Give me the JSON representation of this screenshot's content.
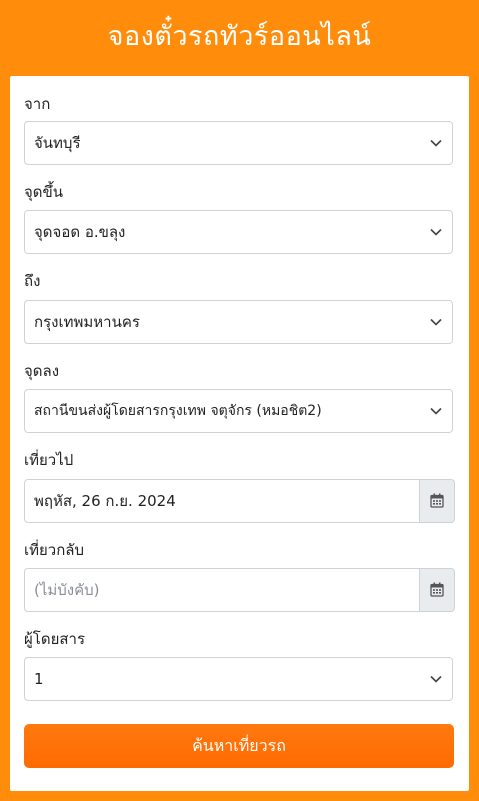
{
  "header": {
    "title": "จองตั๋วรถทัวร์ออนไลน์"
  },
  "form": {
    "from": {
      "label": "จาก",
      "value": "จันทบุรี"
    },
    "pickup": {
      "label": "จุดขึ้น",
      "value": "จุดจอด อ.ขลุง"
    },
    "to": {
      "label": "ถึง",
      "value": "กรุงเทพมหานคร"
    },
    "dropoff": {
      "label": "จุดลง",
      "value": "สถานีขนส่งผู้โดยสารกรุงเทพ จตุจักร (หมอชิต2)"
    },
    "depart": {
      "label": "เที่ยวไป",
      "value": "พฤหัส, 26 ก.ย. 2024"
    },
    "return": {
      "label": "เที่ยวกลับ",
      "placeholder": "(ไม่บังคับ)"
    },
    "passengers": {
      "label": "ผู้โดยสาร",
      "value": "1"
    },
    "search_label": "ค้นหาเที่ยวรถ"
  },
  "colors": {
    "background": "#ff8c0a",
    "button": "#ff6a00"
  },
  "icons": {
    "select": "chevron-down-icon",
    "date": "calendar-icon"
  }
}
